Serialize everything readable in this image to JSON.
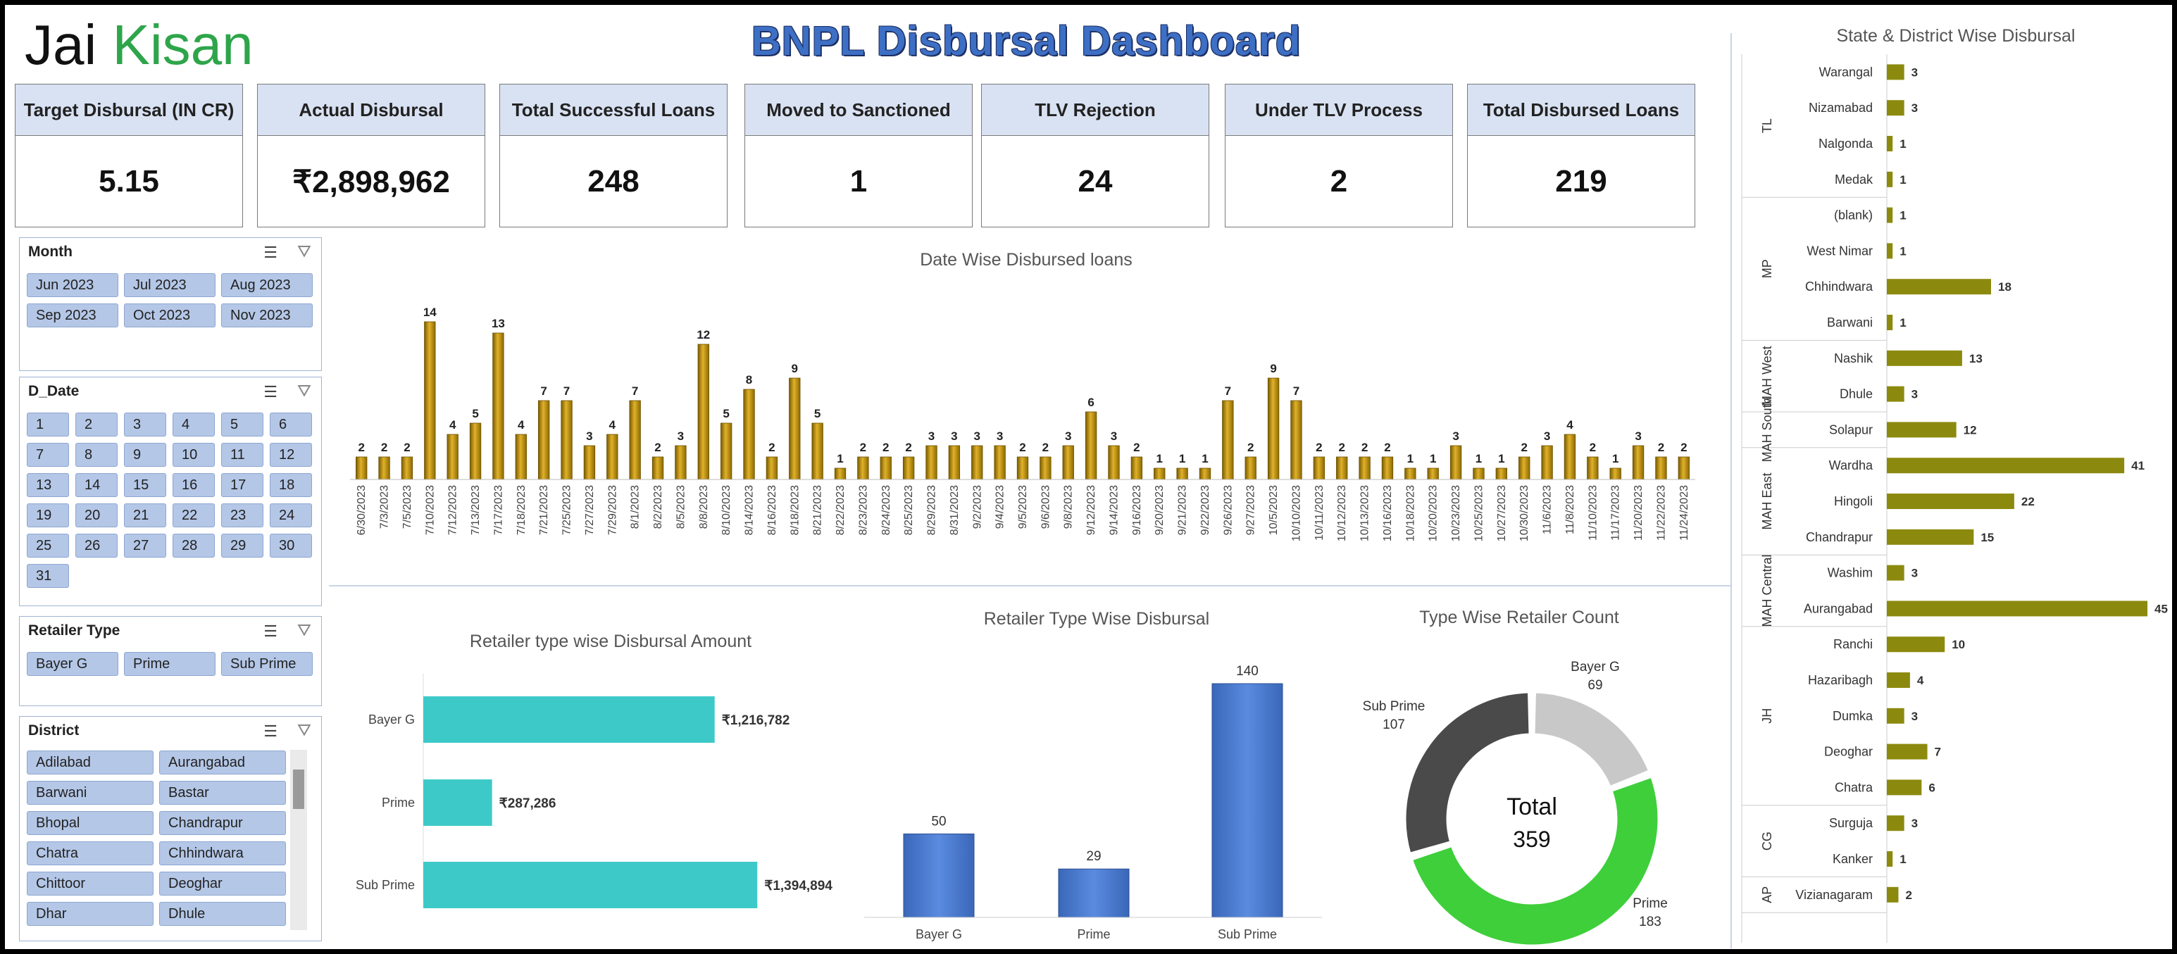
{
  "header": {
    "logo_part1": "Jai",
    "logo_part2": "Kisan",
    "title": "BNPL Disbursal Dashboard"
  },
  "kpis": [
    {
      "label": "Target Disbursal (IN CR)",
      "value": "5.15"
    },
    {
      "label": "Actual Disbursal",
      "value": "₹2,898,962"
    },
    {
      "label": "Total Successful Loans",
      "value": "248"
    },
    {
      "label": "Moved to Sanctioned",
      "value": "1"
    },
    {
      "label": "TLV Rejection",
      "value": "24"
    },
    {
      "label": "Under TLV Process",
      "value": "2"
    },
    {
      "label": "Total Disbursed Loans",
      "value": "219"
    }
  ],
  "slicers": {
    "month": {
      "title": "Month",
      "items": [
        "Jun 2023",
        "Jul 2023",
        "Aug 2023",
        "Sep 2023",
        "Oct 2023",
        "Nov 2023"
      ]
    },
    "d_date": {
      "title": "D_Date",
      "items": [
        "1",
        "2",
        "3",
        "4",
        "5",
        "6",
        "7",
        "8",
        "9",
        "10",
        "11",
        "12",
        "13",
        "14",
        "15",
        "16",
        "17",
        "18",
        "19",
        "20",
        "21",
        "22",
        "23",
        "24",
        "25",
        "26",
        "27",
        "28",
        "29",
        "30",
        "31"
      ]
    },
    "retailer_type": {
      "title": "Retailer Type",
      "items": [
        "Bayer G",
        "Prime",
        "Sub Prime"
      ]
    },
    "district": {
      "title": "District",
      "items": [
        "Adilabad",
        "Aurangabad",
        "Barwani",
        "Bastar",
        "Bhopal",
        "Chandrapur",
        "Chatra",
        "Chhindwara",
        "Chittoor",
        "Deoghar",
        "Dhar",
        "Dhule"
      ]
    }
  },
  "icons": {
    "multiselect": "multi-select-icon",
    "clear_filter": "clear-filter-icon"
  },
  "colors": {
    "gold": "#b8900c",
    "teal": "#3ec9c9",
    "blue": "#4a7bd0",
    "olive": "#8c8a0e",
    "prime": "#3ecf3a",
    "subprime": "#4a4a4a",
    "bayer": "#c8c8c8"
  },
  "chart_data": [
    {
      "type": "bar",
      "title": "Date Wise Disbursed loans",
      "categories": [
        "6/30/2023",
        "7/3/2023",
        "7/5/2023",
        "7/10/2023",
        "7/12/2023",
        "7/13/2023",
        "7/17/2023",
        "7/18/2023",
        "7/21/2023",
        "7/25/2023",
        "7/27/2023",
        "7/29/2023",
        "8/1/2023",
        "8/2/2023",
        "8/5/2023",
        "8/8/2023",
        "8/10/2023",
        "8/14/2023",
        "8/16/2023",
        "8/18/2023",
        "8/21/2023",
        "8/22/2023",
        "8/23/2023",
        "8/24/2023",
        "8/25/2023",
        "8/29/2023",
        "8/31/2023",
        "9/2/2023",
        "9/4/2023",
        "9/5/2023",
        "9/6/2023",
        "9/8/2023",
        "9/12/2023",
        "9/14/2023",
        "9/16/2023",
        "9/20/2023",
        "9/21/2023",
        "9/22/2023",
        "9/26/2023",
        "9/27/2023",
        "10/5/2023",
        "10/10/2023",
        "10/11/2023",
        "10/12/2023",
        "10/13/2023",
        "10/16/2023",
        "10/18/2023",
        "10/20/2023",
        "10/23/2023",
        "10/25/2023",
        "10/27/2023",
        "10/30/2023",
        "11/6/2023",
        "11/8/2023",
        "11/10/2023",
        "11/17/2023",
        "11/20/2023",
        "11/22/2023",
        "11/24/2023"
      ],
      "values": [
        2,
        2,
        2,
        14,
        4,
        5,
        13,
        4,
        7,
        7,
        3,
        4,
        7,
        2,
        3,
        12,
        5,
        8,
        2,
        9,
        5,
        1,
        2,
        2,
        2,
        3,
        3,
        3,
        3,
        2,
        2,
        3,
        6,
        3,
        2,
        1,
        1,
        1,
        7,
        2,
        9,
        7,
        2,
        2,
        2,
        2,
        1,
        1,
        3,
        1,
        1,
        2,
        3,
        4,
        2,
        1,
        3,
        2,
        2
      ]
    },
    {
      "type": "bar",
      "title": "Retailer type wise Disbursal Amount",
      "orientation": "horizontal",
      "categories": [
        "Bayer G",
        "Prime",
        "Sub Prime"
      ],
      "values": [
        1216782,
        287286,
        1394894
      ],
      "labels": [
        "₹1,216,782",
        "₹287,286",
        "₹1,394,894"
      ]
    },
    {
      "type": "bar",
      "title": "Retailer Type Wise Disbursal",
      "categories": [
        "Bayer G",
        "Prime",
        "Sub Prime"
      ],
      "values": [
        50,
        29,
        140
      ]
    },
    {
      "type": "pie",
      "title": "Type Wise Retailer Count",
      "categories": [
        "Bayer G",
        "Prime",
        "Sub Prime"
      ],
      "values": [
        69,
        183,
        107
      ],
      "center_label": "Total",
      "center_value": "359"
    },
    {
      "type": "bar",
      "title": "State & District Wise Disbursal",
      "orientation": "horizontal",
      "groups": [
        {
          "state": "TL",
          "districts": [
            "Warangal",
            "Nizamabad",
            "Nalgonda",
            "Medak"
          ],
          "values": [
            3,
            3,
            1,
            1
          ]
        },
        {
          "state": "MP",
          "districts": [
            "(blank)",
            "West Nimar",
            "Chhindwara",
            "Barwani"
          ],
          "values": [
            1,
            1,
            18,
            1
          ]
        },
        {
          "state": "MAH West",
          "districts": [
            "Nashik",
            "Dhule"
          ],
          "values": [
            13,
            3
          ]
        },
        {
          "state": "MAH South",
          "districts": [
            "Solapur"
          ],
          "values": [
            12
          ]
        },
        {
          "state": "MAH East",
          "districts": [
            "Wardha",
            "Hingoli",
            "Chandrapur"
          ],
          "values": [
            41,
            22,
            15
          ]
        },
        {
          "state": "MAH Central",
          "districts": [
            "Washim",
            "Aurangabad"
          ],
          "values": [
            3,
            45
          ]
        },
        {
          "state": "JH",
          "districts": [
            "Ranchi",
            "Hazaribagh",
            "Dumka",
            "Deoghar",
            "Chatra"
          ],
          "values": [
            10,
            4,
            3,
            7,
            6
          ]
        },
        {
          "state": "CG",
          "districts": [
            "Surguja",
            "Kanker"
          ],
          "values": [
            3,
            1
          ]
        },
        {
          "state": "AP",
          "districts": [
            "Vizianagaram"
          ],
          "values": [
            2
          ]
        }
      ]
    }
  ]
}
